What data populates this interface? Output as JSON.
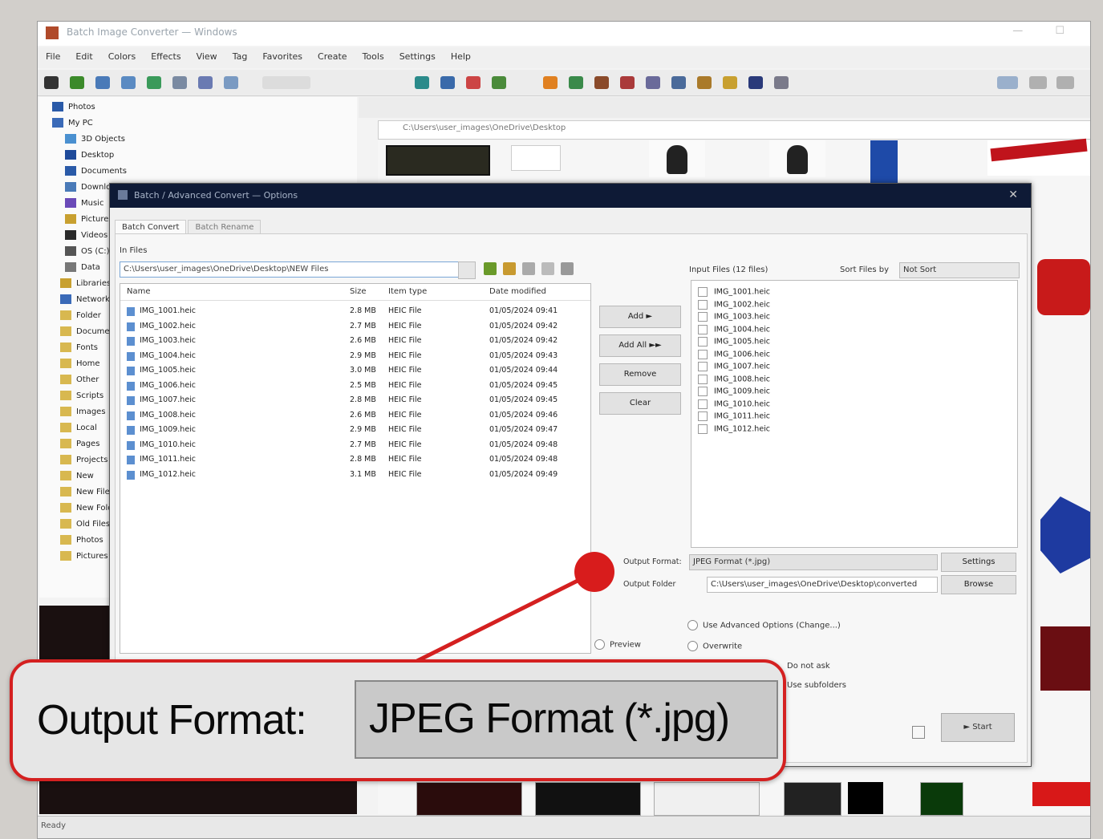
{
  "app": {
    "title": "Batch Image Converter — Windows",
    "menu": [
      "File",
      "Edit",
      "Colors",
      "Effects",
      "View",
      "Tag",
      "Favorites",
      "Create",
      "Tools",
      "Settings",
      "Help"
    ],
    "address": "C:\\Users\\user_images\\OneDrive\\Desktop",
    "tree_items": [
      "Photos",
      "My PC",
      "3D Objects",
      "Desktop",
      "Documents",
      "Downloads",
      "Music",
      "Pictures",
      "Videos",
      "OS (C:)",
      "Data",
      "Libraries",
      "Network",
      "Folder",
      "Documents",
      "Fonts",
      "Home",
      "Other",
      "Scripts",
      "Images",
      "Local",
      "Pages",
      "Projects",
      "New",
      "New Files",
      "New Folder",
      "Old Files",
      "Photos",
      "Pictures"
    ],
    "status": "Ready"
  },
  "dialog": {
    "title": "Batch / Advanced Convert — Options",
    "tabs": [
      "Batch Convert",
      "Batch Rename"
    ],
    "input_files_label": "In Files",
    "path": "C:\\Users\\user_images\\OneDrive\\Desktop\\NEW Files",
    "file_headers": [
      "Name",
      "Size",
      "Item type",
      "Date modified"
    ],
    "files": [
      {
        "name": "IMG_1001.heic",
        "size": "2.8 MB",
        "type": "HEIC File",
        "date": "01/05/2024 09:41"
      },
      {
        "name": "IMG_1002.heic",
        "size": "2.7 MB",
        "type": "HEIC File",
        "date": "01/05/2024 09:42"
      },
      {
        "name": "IMG_1003.heic",
        "size": "2.6 MB",
        "type": "HEIC File",
        "date": "01/05/2024 09:42"
      },
      {
        "name": "IMG_1004.heic",
        "size": "2.9 MB",
        "type": "HEIC File",
        "date": "01/05/2024 09:43"
      },
      {
        "name": "IMG_1005.heic",
        "size": "3.0 MB",
        "type": "HEIC File",
        "date": "01/05/2024 09:44"
      },
      {
        "name": "IMG_1006.heic",
        "size": "2.5 MB",
        "type": "HEIC File",
        "date": "01/05/2024 09:45"
      },
      {
        "name": "IMG_1007.heic",
        "size": "2.8 MB",
        "type": "HEIC File",
        "date": "01/05/2024 09:45"
      },
      {
        "name": "IMG_1008.heic",
        "size": "2.6 MB",
        "type": "HEIC File",
        "date": "01/05/2024 09:46"
      },
      {
        "name": "IMG_1009.heic",
        "size": "2.9 MB",
        "type": "HEIC File",
        "date": "01/05/2024 09:47"
      },
      {
        "name": "IMG_1010.heic",
        "size": "2.7 MB",
        "type": "HEIC File",
        "date": "01/05/2024 09:48"
      },
      {
        "name": "IMG_1011.heic",
        "size": "2.8 MB",
        "type": "HEIC File",
        "date": "01/05/2024 09:48"
      },
      {
        "name": "IMG_1012.heic",
        "size": "3.1 MB",
        "type": "HEIC File",
        "date": "01/05/2024 09:49"
      }
    ],
    "buttons": {
      "add": "Add ►",
      "add_all": "Add All ►►",
      "remove": "Remove",
      "clear": "Clear"
    },
    "selected_label": "Input Files (12 files)",
    "sort_label": "Sort Files by",
    "sort_value": "Not Sort",
    "selected_files": [
      "IMG_1001.heic",
      "IMG_1002.heic",
      "IMG_1003.heic",
      "IMG_1004.heic",
      "IMG_1005.heic",
      "IMG_1006.heic",
      "IMG_1007.heic",
      "IMG_1008.heic",
      "IMG_1009.heic",
      "IMG_1010.heic",
      "IMG_1011.heic",
      "IMG_1012.heic"
    ],
    "output_format_label": "Output Format:",
    "output_format_value": "JPEG Format (*.jpg)",
    "settings_label": "Settings",
    "output_folder_label": "Output Folder",
    "output_folder_value": "C:\\Users\\user_images\\OneDrive\\Desktop\\converted",
    "browse_label": "Browse",
    "advanced_label": "Use Advanced Options (Change...)",
    "preview_label": "Preview",
    "overwrite_label": "Overwrite",
    "option1": "Do not ask",
    "option2": "Use subfolders",
    "start_label": "► Start"
  },
  "callout": {
    "label": "Output Format:",
    "value": "JPEG Format (*.jpg)",
    "accent": "#d42020"
  }
}
